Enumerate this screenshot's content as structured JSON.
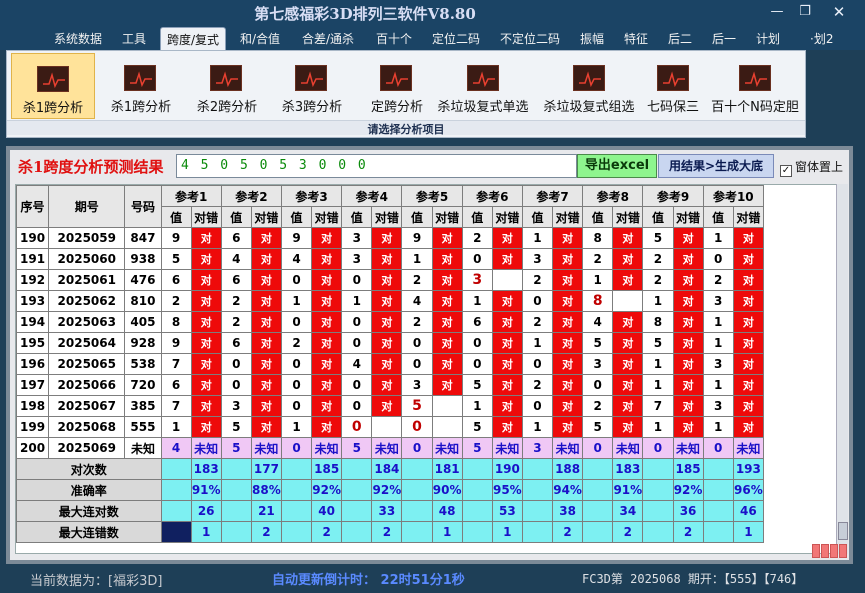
{
  "window": {
    "title": "第七感福彩3D排列三软件V8.80"
  },
  "menu": [
    "系统数据",
    "工具",
    "跨度/复式",
    "和/合值",
    "合差/通杀",
    "百十个",
    "定位二码",
    "不定位二码",
    "振幅",
    "特征",
    "后二",
    "后一",
    "计划",
    "·划2"
  ],
  "ribbon": {
    "buttons": [
      "杀1跨分析",
      "杀1跨分析",
      "杀2跨分析",
      "杀3跨分析",
      "定跨分析",
      "杀垃圾复式单选",
      "杀垃圾复式组选",
      "七码保三",
      "百十个N码定胆"
    ],
    "caption": "请选择分析项目"
  },
  "result": {
    "label": "杀1跨度分析预测结果",
    "value": "4 5 0 5 0 5 3 0 0 0"
  },
  "buttons": {
    "export": "导出excel",
    "generate": "用结果>生成大底"
  },
  "topmost": {
    "label": "窗体置上",
    "checked_mark": "✓"
  },
  "table": {
    "headers": {
      "seq": "序号",
      "period": "期号",
      "number": "号码",
      "val": "值",
      "dc": "对错",
      "refs": [
        "参考1",
        "参考2",
        "参考3",
        "参考4",
        "参考5",
        "参考6",
        "参考7",
        "参考8",
        "参考9",
        "参考10"
      ]
    },
    "rows": [
      {
        "seq": "190",
        "period": "2025059",
        "number": "847",
        "cells": [
          [
            "9",
            "对"
          ],
          [
            "6",
            "对"
          ],
          [
            "9",
            "对"
          ],
          [
            "3",
            "对"
          ],
          [
            "9",
            "对"
          ],
          [
            "2",
            "对"
          ],
          [
            "1",
            "对"
          ],
          [
            "8",
            "对"
          ],
          [
            "5",
            "对"
          ],
          [
            "1",
            "对"
          ]
        ]
      },
      {
        "seq": "191",
        "period": "2025060",
        "number": "938",
        "cells": [
          [
            "5",
            "对"
          ],
          [
            "4",
            "对"
          ],
          [
            "4",
            "对"
          ],
          [
            "3",
            "对"
          ],
          [
            "1",
            "对"
          ],
          [
            "0",
            "对"
          ],
          [
            "3",
            "对"
          ],
          [
            "2",
            "对"
          ],
          [
            "2",
            "对"
          ],
          [
            "0",
            "对"
          ]
        ]
      },
      {
        "seq": "192",
        "period": "2025061",
        "number": "476",
        "cells": [
          [
            "6",
            "对"
          ],
          [
            "6",
            "对"
          ],
          [
            "0",
            "对"
          ],
          [
            "0",
            "对"
          ],
          [
            "2",
            "对"
          ],
          [
            "3",
            ""
          ],
          [
            "2",
            "对"
          ],
          [
            "1",
            "对"
          ],
          [
            "2",
            "对"
          ],
          [
            "2",
            "对"
          ]
        ]
      },
      {
        "seq": "193",
        "period": "2025062",
        "number": "810",
        "cells": [
          [
            "2",
            "对"
          ],
          [
            "2",
            "对"
          ],
          [
            "1",
            "对"
          ],
          [
            "1",
            "对"
          ],
          [
            "4",
            "对"
          ],
          [
            "1",
            "对"
          ],
          [
            "0",
            "对"
          ],
          [
            "8",
            ""
          ],
          [
            "1",
            "对"
          ],
          [
            "3",
            "对"
          ]
        ]
      },
      {
        "seq": "194",
        "period": "2025063",
        "number": "405",
        "cells": [
          [
            "8",
            "对"
          ],
          [
            "2",
            "对"
          ],
          [
            "0",
            "对"
          ],
          [
            "0",
            "对"
          ],
          [
            "2",
            "对"
          ],
          [
            "6",
            "对"
          ],
          [
            "2",
            "对"
          ],
          [
            "4",
            "对"
          ],
          [
            "8",
            "对"
          ],
          [
            "1",
            "对"
          ]
        ]
      },
      {
        "seq": "195",
        "period": "2025064",
        "number": "928",
        "cells": [
          [
            "9",
            "对"
          ],
          [
            "6",
            "对"
          ],
          [
            "2",
            "对"
          ],
          [
            "0",
            "对"
          ],
          [
            "0",
            "对"
          ],
          [
            "0",
            "对"
          ],
          [
            "1",
            "对"
          ],
          [
            "5",
            "对"
          ],
          [
            "5",
            "对"
          ],
          [
            "1",
            "对"
          ]
        ]
      },
      {
        "seq": "196",
        "period": "2025065",
        "number": "538",
        "cells": [
          [
            "7",
            "对"
          ],
          [
            "0",
            "对"
          ],
          [
            "0",
            "对"
          ],
          [
            "4",
            "对"
          ],
          [
            "0",
            "对"
          ],
          [
            "0",
            "对"
          ],
          [
            "0",
            "对"
          ],
          [
            "3",
            "对"
          ],
          [
            "1",
            "对"
          ],
          [
            "3",
            "对"
          ]
        ]
      },
      {
        "seq": "197",
        "period": "2025066",
        "number": "720",
        "cells": [
          [
            "6",
            "对"
          ],
          [
            "0",
            "对"
          ],
          [
            "0",
            "对"
          ],
          [
            "0",
            "对"
          ],
          [
            "3",
            "对"
          ],
          [
            "5",
            "对"
          ],
          [
            "2",
            "对"
          ],
          [
            "0",
            "对"
          ],
          [
            "1",
            "对"
          ],
          [
            "1",
            "对"
          ]
        ]
      },
      {
        "seq": "198",
        "period": "2025067",
        "number": "385",
        "cells": [
          [
            "7",
            "对"
          ],
          [
            "3",
            "对"
          ],
          [
            "0",
            "对"
          ],
          [
            "0",
            "对"
          ],
          [
            "5",
            ""
          ],
          [
            "1",
            "对"
          ],
          [
            "0",
            "对"
          ],
          [
            "2",
            "对"
          ],
          [
            "7",
            "对"
          ],
          [
            "3",
            "对"
          ]
        ]
      },
      {
        "seq": "199",
        "period": "2025068",
        "number": "555",
        "cells": [
          [
            "1",
            "对"
          ],
          [
            "5",
            "对"
          ],
          [
            "1",
            "对"
          ],
          [
            "0",
            ""
          ],
          [
            "0",
            ""
          ],
          [
            "5",
            "对"
          ],
          [
            "1",
            "对"
          ],
          [
            "5",
            "对"
          ],
          [
            "1",
            "对"
          ],
          [
            "1",
            "对"
          ]
        ]
      }
    ],
    "highlight": [
      [
        2,
        5
      ],
      [
        3,
        7
      ],
      [
        8,
        4
      ],
      [
        9,
        3
      ],
      [
        9,
        4
      ]
    ],
    "predict": {
      "seq": "200",
      "period": "2025069",
      "number": "未知",
      "cells": [
        [
          "4",
          "未知"
        ],
        [
          "5",
          "未知"
        ],
        [
          "0",
          "未知"
        ],
        [
          "5",
          "未知"
        ],
        [
          "0",
          "未知"
        ],
        [
          "5",
          "未知"
        ],
        [
          "3",
          "未知"
        ],
        [
          "0",
          "未知"
        ],
        [
          "0",
          "未知"
        ],
        [
          "0",
          "未知"
        ]
      ]
    },
    "stats": [
      {
        "label": "对次数",
        "values": [
          "183",
          "177",
          "185",
          "184",
          "181",
          "190",
          "188",
          "183",
          "185",
          "193"
        ]
      },
      {
        "label": "准确率",
        "values": [
          "91%",
          "88%",
          "92%",
          "92%",
          "90%",
          "95%",
          "94%",
          "91%",
          "92%",
          "96%"
        ]
      },
      {
        "label": "最大连对数",
        "values": [
          "26",
          "21",
          "40",
          "33",
          "48",
          "53",
          "38",
          "34",
          "36",
          "46"
        ]
      },
      {
        "label": "最大连错数",
        "values": [
          "1",
          "2",
          "2",
          "2",
          "1",
          "1",
          "2",
          "2",
          "2",
          "1"
        ]
      }
    ]
  },
  "status": {
    "current": "当前数据为：[福彩3D]",
    "countdown": "自动更新倒计时： 22时51分1秒",
    "latest": "FC3D第 2025068 期开：【555】【746】"
  },
  "colors": {
    "red_cell": "#ee0a0a",
    "predict_row": "#f0c8f5",
    "stat_cell": "#7df0f2",
    "blue_text": "#1a10c8"
  }
}
